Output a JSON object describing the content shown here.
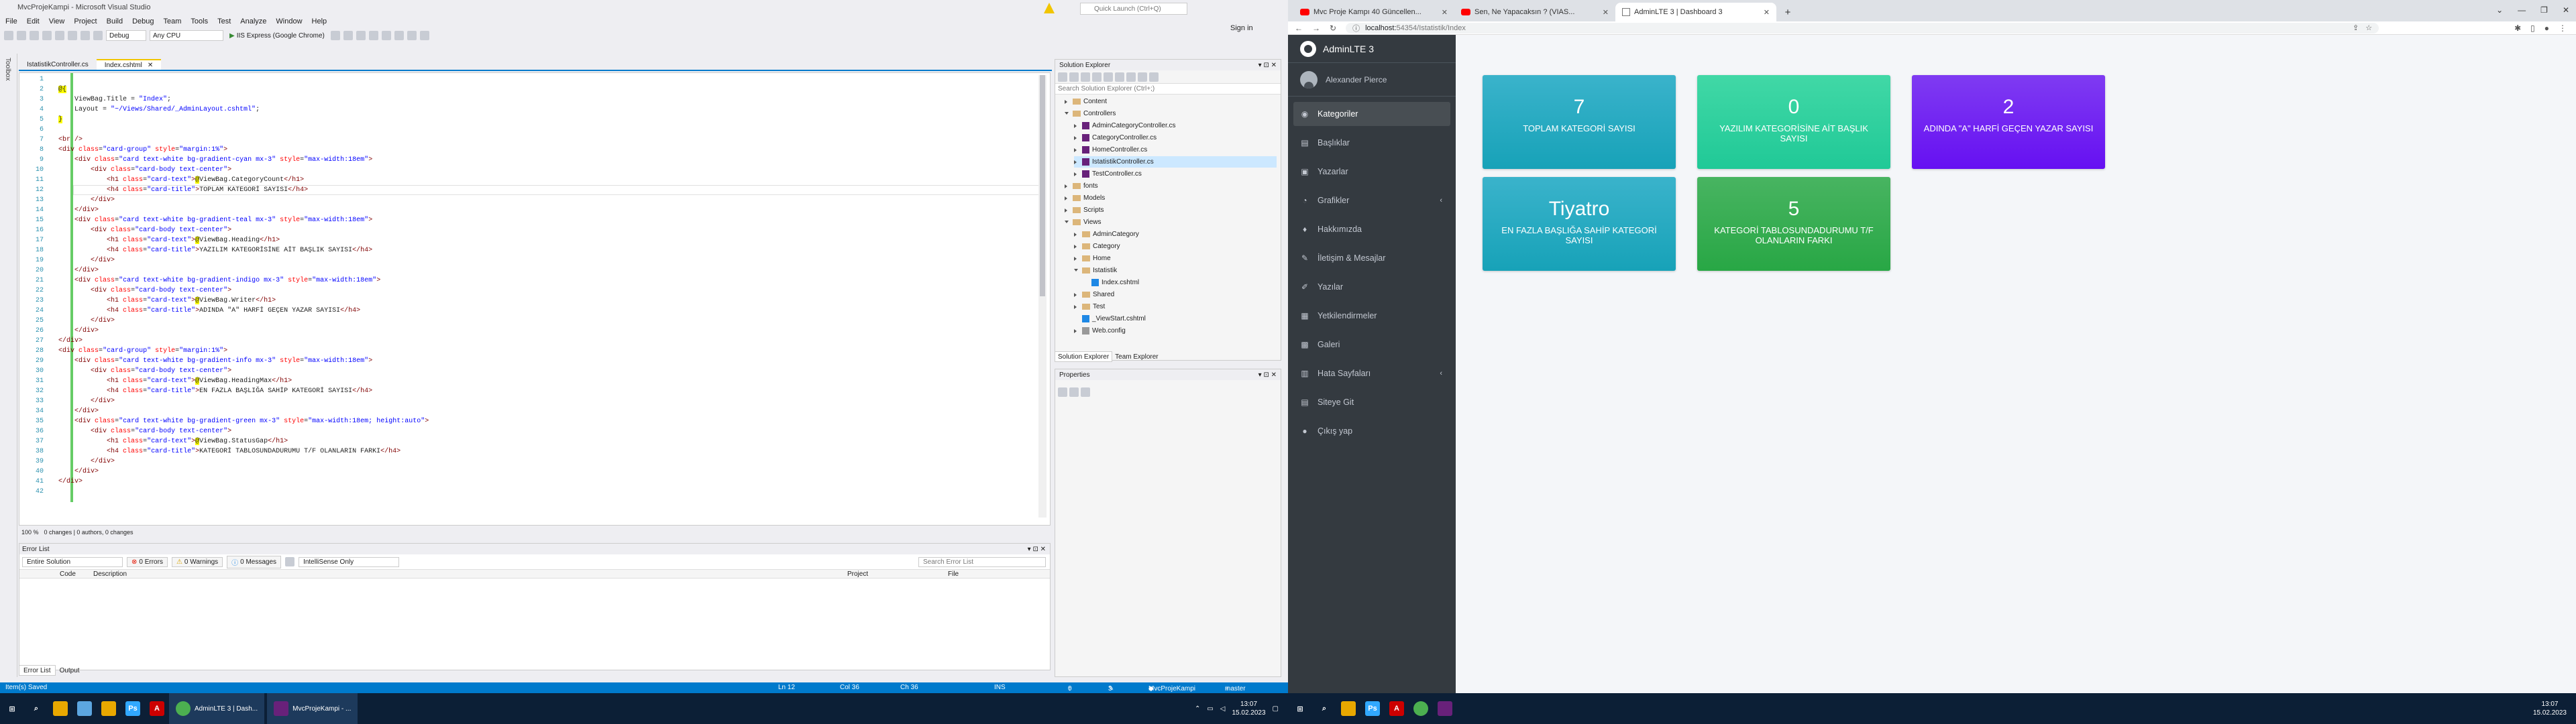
{
  "vs": {
    "title": "MvcProjeKampi - Microsoft Visual Studio",
    "menu": [
      "File",
      "Edit",
      "View",
      "Project",
      "Build",
      "Debug",
      "Team",
      "Tools",
      "Test",
      "Analyze",
      "Window",
      "Help"
    ],
    "toolbar": {
      "config": "Debug",
      "platform": "Any CPU",
      "run": "IIS Express (Google Chrome)"
    },
    "quick_launch": "Quick Launch (Ctrl+Q)",
    "sign_in": "Sign in",
    "side_tabs": [
      "Toolbox"
    ],
    "doc_tabs": [
      {
        "label": "IstatistikController.cs",
        "active": false
      },
      {
        "label": "Index.cshtml",
        "active": true
      }
    ],
    "code_lines": [
      {
        "n": "1",
        "html": ""
      },
      {
        "n": "2",
        "html": "<span class='razor'>@{</span>"
      },
      {
        "n": "3",
        "html": "    ViewBag.Title = <span class='val'>\"Index\"</span>;"
      },
      {
        "n": "4",
        "html": "    Layout = <span class='val'>\"~/Views/Shared/_AdminLayout.cshtml\"</span>;"
      },
      {
        "n": "5",
        "html": "<span class='razor'>}</span>"
      },
      {
        "n": "6",
        "html": ""
      },
      {
        "n": "7",
        "html": "<span class='tag'>&lt;br /&gt;</span>"
      },
      {
        "n": "8",
        "html": "<span class='tag'>&lt;div</span> <span class='attr'>class</span>=<span class='val'>\"card-group\"</span> <span class='attr'>style</span>=<span class='val'>\"margin:1%\"</span><span class='tag'>&gt;</span>"
      },
      {
        "n": "9",
        "html": "    <span class='tag'>&lt;div</span> <span class='attr'>class</span>=<span class='val'>\"card text-white bg-gradient-cyan mx-3\"</span> <span class='attr'>style</span>=<span class='val'>\"max-width:18em\"</span><span class='tag'>&gt;</span>"
      },
      {
        "n": "10",
        "html": "        <span class='tag'>&lt;div</span> <span class='attr'>class</span>=<span class='val'>\"card-body text-center\"</span><span class='tag'>&gt;</span>"
      },
      {
        "n": "11",
        "html": "            <span class='tag'>&lt;h1</span> <span class='attr'>class</span>=<span class='val'>\"card-text\"</span><span class='tag'>&gt;</span><span class='razor'>@</span>ViewBag.CategoryCount<span class='tag'>&lt;/h1&gt;</span>"
      },
      {
        "n": "12",
        "html": "            <span class='tag'>&lt;h4</span> <span class='attr'>class</span>=<span class='val'>\"card-title\"</span><span class='tag'>&gt;</span>TOPLAM KATEGORİ SAYISI<span class='tag'>&lt;/h4&gt;</span>"
      },
      {
        "n": "13",
        "html": "        <span class='tag'>&lt;/div&gt;</span>"
      },
      {
        "n": "14",
        "html": "    <span class='tag'>&lt;/div&gt;</span>"
      },
      {
        "n": "15",
        "html": "    <span class='tag'>&lt;div</span> <span class='attr'>class</span>=<span class='val'>\"card text-white bg-gradient-teal mx-3\"</span> <span class='attr'>style</span>=<span class='val'>\"max-width:18em\"</span><span class='tag'>&gt;</span>"
      },
      {
        "n": "16",
        "html": "        <span class='tag'>&lt;div</span> <span class='attr'>class</span>=<span class='val'>\"card-body text-center\"</span><span class='tag'>&gt;</span>"
      },
      {
        "n": "17",
        "html": "            <span class='tag'>&lt;h1</span> <span class='attr'>class</span>=<span class='val'>\"card-text\"</span><span class='tag'>&gt;</span><span class='razor'>@</span>ViewBag.Heading<span class='tag'>&lt;/h1&gt;</span>"
      },
      {
        "n": "18",
        "html": "            <span class='tag'>&lt;h4</span> <span class='attr'>class</span>=<span class='val'>\"card-title\"</span><span class='tag'>&gt;</span>YAZILIM KATEGORİSİNE AİT BAŞLIK SAYISI<span class='tag'>&lt;/h4&gt;</span>"
      },
      {
        "n": "19",
        "html": "        <span class='tag'>&lt;/div&gt;</span>"
      },
      {
        "n": "20",
        "html": "    <span class='tag'>&lt;/div&gt;</span>"
      },
      {
        "n": "21",
        "html": "    <span class='tag'>&lt;div</span> <span class='attr'>class</span>=<span class='val'>\"card text-white bg-gradient-indigo mx-3\"</span> <span class='attr'>style</span>=<span class='val'>\"max-width:18em\"</span><span class='tag'>&gt;</span>"
      },
      {
        "n": "22",
        "html": "        <span class='tag'>&lt;div</span> <span class='attr'>class</span>=<span class='val'>\"card-body text-center\"</span><span class='tag'>&gt;</span>"
      },
      {
        "n": "23",
        "html": "            <span class='tag'>&lt;h1</span> <span class='attr'>class</span>=<span class='val'>\"card-text\"</span><span class='tag'>&gt;</span><span class='razor'>@</span>ViewBag.Writer<span class='tag'>&lt;/h1&gt;</span>"
      },
      {
        "n": "24",
        "html": "            <span class='tag'>&lt;h4</span> <span class='attr'>class</span>=<span class='val'>\"card-title\"</span><span class='tag'>&gt;</span>ADINDA \"A\" HARFİ GEÇEN YAZAR SAYISI<span class='tag'>&lt;/h4&gt;</span>"
      },
      {
        "n": "25",
        "html": "        <span class='tag'>&lt;/div&gt;</span>"
      },
      {
        "n": "26",
        "html": "    <span class='tag'>&lt;/div&gt;</span>"
      },
      {
        "n": "27",
        "html": "<span class='tag'>&lt;/div&gt;</span>"
      },
      {
        "n": "28",
        "html": "<span class='tag'>&lt;div</span> <span class='attr'>class</span>=<span class='val'>\"card-group\"</span> <span class='attr'>style</span>=<span class='val'>\"margin:1%\"</span><span class='tag'>&gt;</span>"
      },
      {
        "n": "29",
        "html": "    <span class='tag'>&lt;div</span> <span class='attr'>class</span>=<span class='val'>\"card text-white bg-gradient-info mx-3\"</span> <span class='attr'>style</span>=<span class='val'>\"max-width:18em\"</span><span class='tag'>&gt;</span>"
      },
      {
        "n": "30",
        "html": "        <span class='tag'>&lt;div</span> <span class='attr'>class</span>=<span class='val'>\"card-body text-center\"</span><span class='tag'>&gt;</span>"
      },
      {
        "n": "31",
        "html": "            <span class='tag'>&lt;h1</span> <span class='attr'>class</span>=<span class='val'>\"card-text\"</span><span class='tag'>&gt;</span><span class='razor'>@</span>ViewBag.HeadingMax<span class='tag'>&lt;/h1&gt;</span>"
      },
      {
        "n": "32",
        "html": "            <span class='tag'>&lt;h4</span> <span class='attr'>class</span>=<span class='val'>\"card-title\"</span><span class='tag'>&gt;</span>EN FAZLA BAŞLIĞA SAHİP KATEGORİ SAYISI<span class='tag'>&lt;/h4&gt;</span>"
      },
      {
        "n": "33",
        "html": "        <span class='tag'>&lt;/div&gt;</span>"
      },
      {
        "n": "34",
        "html": "    <span class='tag'>&lt;/div&gt;</span>"
      },
      {
        "n": "35",
        "html": "    <span class='tag'>&lt;div</span> <span class='attr'>class</span>=<span class='val'>\"card text-white bg-gradient-green mx-3\"</span> <span class='attr'>style</span>=<span class='val'>\"max-width:18em; height:auto\"</span><span class='tag'>&gt;</span>"
      },
      {
        "n": "36",
        "html": "        <span class='tag'>&lt;div</span> <span class='attr'>class</span>=<span class='val'>\"card-body text-center\"</span><span class='tag'>&gt;</span>"
      },
      {
        "n": "37",
        "html": "            <span class='tag'>&lt;h1</span> <span class='attr'>class</span>=<span class='val'>\"card-text\"</span><span class='tag'>&gt;</span><span class='razor'>@</span>ViewBag.StatusGap<span class='tag'>&lt;/h1&gt;</span>"
      },
      {
        "n": "38",
        "html": "            <span class='tag'>&lt;h4</span> <span class='attr'>class</span>=<span class='val'>\"card-title\"</span><span class='tag'>&gt;</span>KATEGORİ TABLOSUNDADURUMU T/F OLANLARIN FARKI<span class='tag'>&lt;/h4&gt;</span>"
      },
      {
        "n": "39",
        "html": "        <span class='tag'>&lt;/div&gt;</span>"
      },
      {
        "n": "40",
        "html": "    <span class='tag'>&lt;/div&gt;</span>"
      },
      {
        "n": "41",
        "html": "<span class='tag'>&lt;/div&gt;</span>"
      },
      {
        "n": "42",
        "html": ""
      }
    ],
    "editor_status": {
      "zoom": "100 %",
      "changes": "0 changes | 0 authors, 0 changes"
    },
    "error_list": {
      "title": "Error List",
      "scope": "Entire Solution",
      "errors": "0 Errors",
      "warnings": "0 Warnings",
      "messages": "0 Messages",
      "build": "IntelliSense Only",
      "search": "Search Error List",
      "cols": [
        "Code",
        "Description",
        "Project",
        "File"
      ]
    },
    "bottom_tabs": [
      "Error List",
      "Output"
    ],
    "solution_explorer": {
      "title": "Solution Explorer",
      "search": "Search Solution Explorer (Ctrl+;)",
      "items": [
        {
          "label": "Content",
          "type": "folder",
          "indent": 1,
          "state": "closed"
        },
        {
          "label": "Controllers",
          "type": "folder",
          "indent": 1,
          "state": "open"
        },
        {
          "label": "AdminCategoryController.cs",
          "type": "cs",
          "indent": 2,
          "state": "closed"
        },
        {
          "label": "CategoryController.cs",
          "type": "cs",
          "indent": 2,
          "state": "closed"
        },
        {
          "label": "HomeController.cs",
          "type": "cs",
          "indent": 2,
          "state": "closed"
        },
        {
          "label": "IstatistikController.cs",
          "type": "cs",
          "indent": 2,
          "state": "closed",
          "selected": true
        },
        {
          "label": "TestController.cs",
          "type": "cs",
          "indent": 2,
          "state": "closed"
        },
        {
          "label": "fonts",
          "type": "folder",
          "indent": 1,
          "state": "closed"
        },
        {
          "label": "Models",
          "type": "folder",
          "indent": 1,
          "state": "closed"
        },
        {
          "label": "Scripts",
          "type": "folder",
          "indent": 1,
          "state": "closed"
        },
        {
          "label": "Views",
          "type": "folder",
          "indent": 1,
          "state": "open"
        },
        {
          "label": "AdminCategory",
          "type": "folder",
          "indent": 2,
          "state": "closed"
        },
        {
          "label": "Category",
          "type": "folder",
          "indent": 2,
          "state": "closed"
        },
        {
          "label": "Home",
          "type": "folder",
          "indent": 2,
          "state": "closed"
        },
        {
          "label": "Istatistik",
          "type": "folder",
          "indent": 2,
          "state": "open"
        },
        {
          "label": "Index.cshtml",
          "type": "cshtml",
          "indent": 3,
          "state": "none"
        },
        {
          "label": "Shared",
          "type": "folder",
          "indent": 2,
          "state": "closed"
        },
        {
          "label": "Test",
          "type": "folder",
          "indent": 2,
          "state": "closed"
        },
        {
          "label": "_ViewStart.cshtml",
          "type": "cshtml",
          "indent": 2,
          "state": "none"
        },
        {
          "label": "Web.config",
          "type": "cfg",
          "indent": 2,
          "state": "closed"
        }
      ],
      "tabs": [
        "Solution Explorer",
        "Team Explorer"
      ]
    },
    "properties": {
      "title": "Properties"
    },
    "status": {
      "saved": "Item(s) Saved",
      "ln": "Ln 12",
      "col": "Col 36",
      "ch": "Ch 36",
      "ins": "INS",
      "up": "0",
      "pen": "3",
      "repo": "MvcProjeKampi",
      "branch": "master"
    }
  },
  "taskbar_left": {
    "apps": [
      {
        "label": "AdminLTE 3 | Dash..."
      },
      {
        "label": "MvcProjeKampi - ..."
      }
    ],
    "time": "13:07",
    "date": "15.02.2023"
  },
  "taskbar_right": {
    "time": "13:07",
    "date": "15.02.2023"
  },
  "chrome": {
    "tabs": [
      {
        "label": "Mvc Proje Kampı 40 Güncellen...",
        "icon": "youtube",
        "active": false
      },
      {
        "label": "Sen, Ne Yapacaksın ? (VIAS...",
        "icon": "youtube",
        "active": false
      },
      {
        "label": "AdminLTE 3 | Dashboard 3",
        "icon": "page",
        "active": true
      }
    ],
    "url_host": "localhost:",
    "url_rest": "54354/Istatistik/Index"
  },
  "admin": {
    "brand": "AdminLTE 3",
    "user": "Alexander Pierce",
    "nav": [
      {
        "label": "Kategoriler",
        "icon": "◉",
        "active": true,
        "chev": false
      },
      {
        "label": "Başlıklar",
        "icon": "▤",
        "active": false,
        "chev": false
      },
      {
        "label": "Yazarlar",
        "icon": "▣",
        "active": false,
        "chev": false
      },
      {
        "label": "Grafikler",
        "icon": "◔",
        "active": false,
        "chev": true
      },
      {
        "label": "Hakkımızda",
        "icon": "♦",
        "active": false,
        "chev": false
      },
      {
        "label": "İletişim & Mesajlar",
        "icon": "✎",
        "active": false,
        "chev": false
      },
      {
        "label": "Yazılar",
        "icon": "✐",
        "active": false,
        "chev": false
      },
      {
        "label": "Yetkilendirmeler",
        "icon": "▦",
        "active": false,
        "chev": false
      },
      {
        "label": "Galeri",
        "icon": "▩",
        "active": false,
        "chev": false
      },
      {
        "label": "Hata Sayfaları",
        "icon": "▥",
        "active": false,
        "chev": true
      },
      {
        "label": "Siteye Git",
        "icon": "▤",
        "active": false,
        "chev": false
      },
      {
        "label": "Çıkış yap",
        "icon": "●",
        "active": false,
        "chev": false
      }
    ],
    "boxes": [
      {
        "num": "7",
        "label": "TOPLAM KATEGORİ SAYISI",
        "color": "cyan"
      },
      {
        "num": "0",
        "label": "YAZILIM KATEGORİSİNE AİT BAŞLIK SAYISI",
        "color": "teal"
      },
      {
        "num": "2",
        "label": "ADINDA \"A\" HARFİ GEÇEN YAZAR SAYISI",
        "color": "indigo"
      },
      {
        "num": "Tiyatro",
        "label": "EN FAZLA BAŞLIĞA SAHİP KATEGORİ SAYISI",
        "color": "info"
      },
      {
        "num": "5",
        "label": "KATEGORİ TABLOSUNDADURUMU T/F OLANLARIN FARKI",
        "color": "green"
      }
    ]
  }
}
